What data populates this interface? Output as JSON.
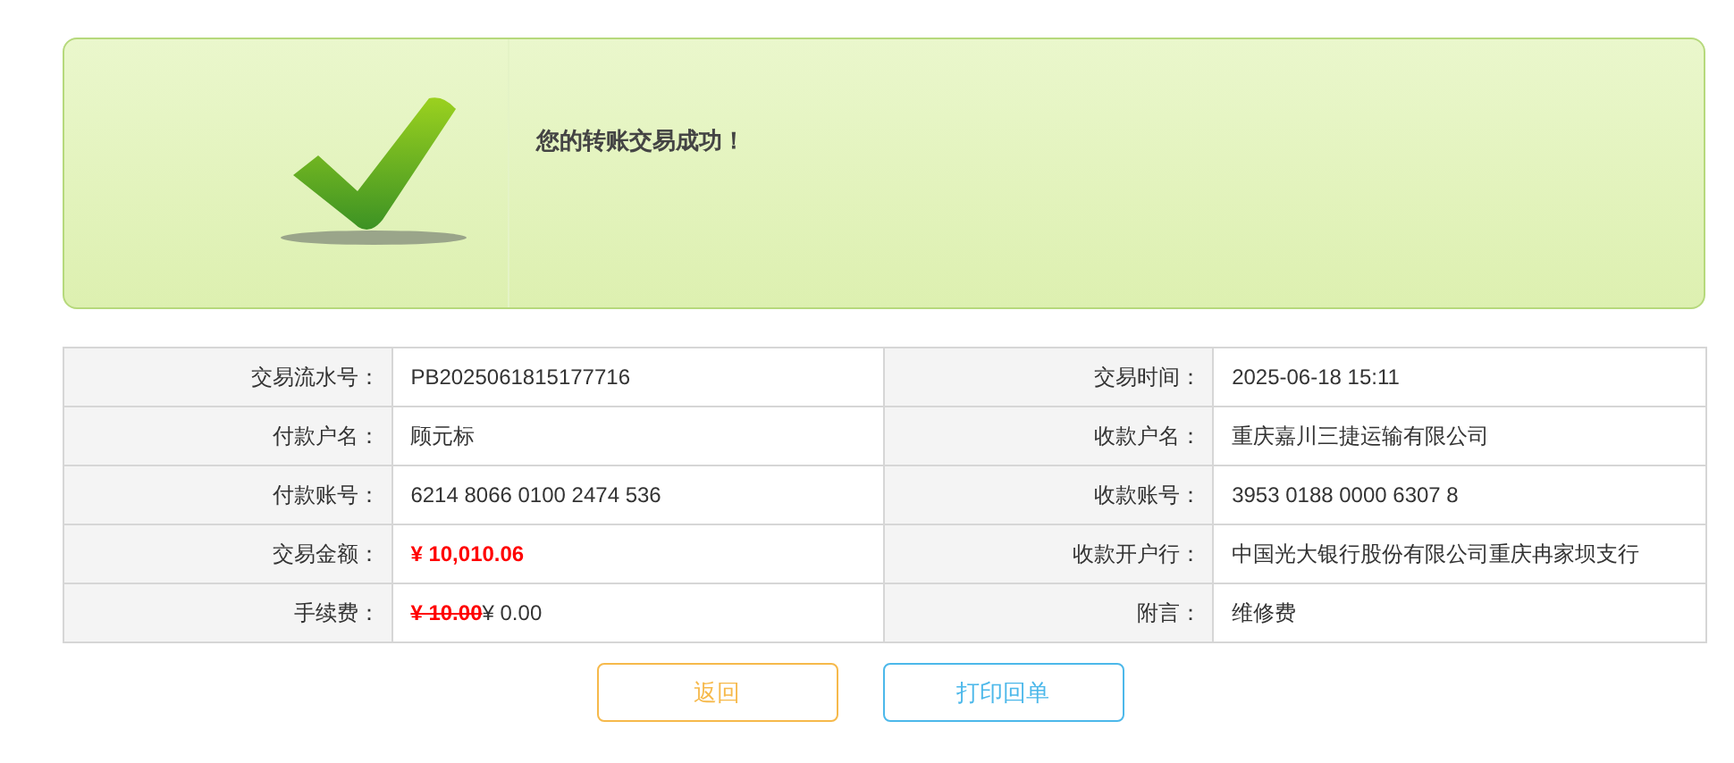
{
  "banner": {
    "message": "您的转账交易成功！"
  },
  "rows": [
    [
      {
        "label": "交易流水号：",
        "kind": "plain",
        "value": "PB2025061815177716"
      },
      {
        "label": "交易时间：",
        "kind": "plain",
        "value": "2025-06-18 15:11"
      }
    ],
    [
      {
        "label": "付款户名：",
        "kind": "plain",
        "value": "顾元标"
      },
      {
        "label": "收款户名：",
        "kind": "plain",
        "value": "重庆嘉川三捷运输有限公司"
      }
    ],
    [
      {
        "label": "付款账号：",
        "kind": "plain",
        "value": "6214 8066 0100 2474 536"
      },
      {
        "label": "收款账号：",
        "kind": "plain",
        "value": "3953 0188 0000 6307 8"
      }
    ],
    [
      {
        "label": "交易金额：",
        "kind": "amount",
        "value": "¥ 10,010.06"
      },
      {
        "label": "收款开户行：",
        "kind": "plain",
        "value": "中国光大银行股份有限公司重庆冉家坝支行"
      }
    ],
    [
      {
        "label": "手续费：",
        "kind": "fee",
        "old": "¥ 10.00",
        "value": "¥ 0.00"
      },
      {
        "label": "附言：",
        "kind": "plain",
        "value": "维修费"
      }
    ]
  ],
  "buttons": [
    {
      "label": "返回",
      "kind": "back"
    },
    {
      "label": "打印回单",
      "kind": "print"
    }
  ]
}
